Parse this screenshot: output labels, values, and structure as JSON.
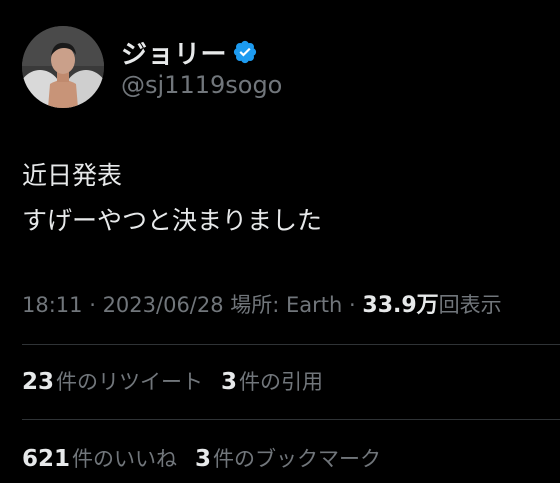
{
  "profile": {
    "display_name": "ジョリー",
    "handle": "@sj1119sogo",
    "verified_color": "#1d9bf0"
  },
  "tweet": {
    "lines": [
      "近日発表",
      "すげーやつと決まりました"
    ]
  },
  "meta": {
    "time": "18:11",
    "dot1": " · ",
    "date": "2023/06/28",
    "location": " 場所: Earth",
    "dot2": " · ",
    "views_count": "33.9万",
    "views_label": "回表示"
  },
  "stats_row1": {
    "retweets_count": "23",
    "retweets_label": "件のリツイート",
    "quotes_count": "3",
    "quotes_label": "件の引用"
  },
  "stats_row2": {
    "likes_count": "621",
    "likes_label": "件のいいね",
    "bookmarks_count": "3",
    "bookmarks_label": "件のブックマーク"
  },
  "colors": {
    "background": "#000000",
    "text_primary": "#e7e9ea",
    "text_secondary": "#71767b",
    "divider": "#2f3336"
  },
  "icons": {
    "verified": "verified-badge-icon"
  }
}
